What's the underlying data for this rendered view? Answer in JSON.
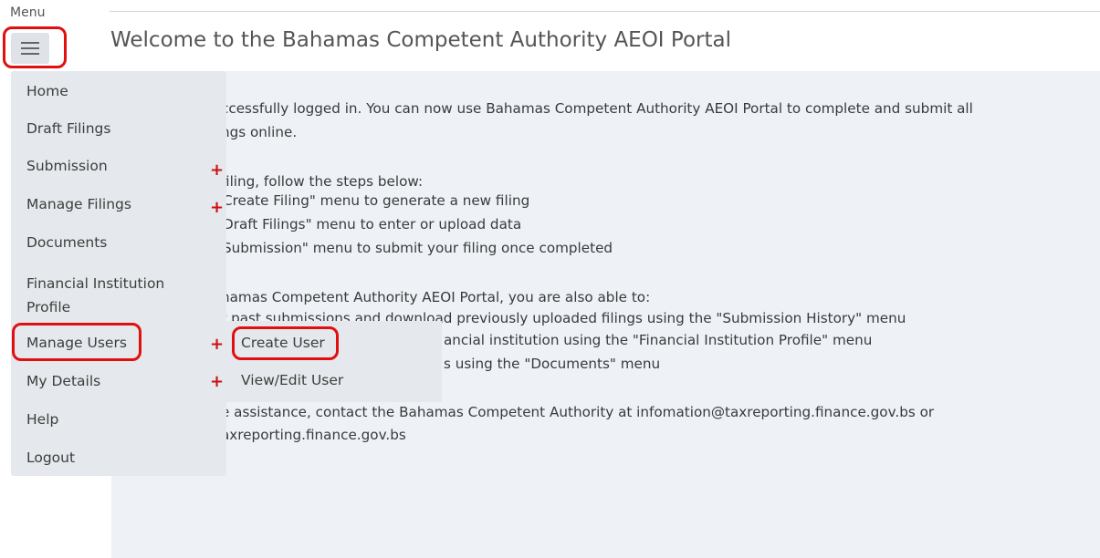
{
  "menu": {
    "label": "Menu",
    "items": [
      {
        "label": "Home"
      },
      {
        "label": "Draft Filings"
      },
      {
        "label": "Submission",
        "expand_symbol": "+"
      },
      {
        "label": "Manage Filings",
        "expand_symbol": "+"
      },
      {
        "label": "Documents"
      },
      {
        "label": "Financial Institution Profile"
      },
      {
        "label": "Manage Users",
        "expand_symbol": "+"
      },
      {
        "label": "My Details"
      },
      {
        "label": "Help"
      },
      {
        "label": "Logout"
      }
    ],
    "submenu": [
      {
        "label": "Create User",
        "expand_symbol": "+"
      },
      {
        "label": "View/Edit User",
        "expand_symbol": "+"
      }
    ]
  },
  "page": {
    "title": "Welcome to the Bahamas Competent Authority AEOI Portal",
    "lines": [
      "ccessfully logged in. You can now use Bahamas Competent Authority AEOI Portal to complete and submit all",
      "ngs online.",
      "filing, follow the steps below:",
      "Create Filing\" menu to generate a new filing",
      "Draft Filings\" menu to enter or upload data",
      "Submission\" menu to submit your filing once completed",
      "hamas Competent Authority AEOI Portal, you are also able to:",
      "r past submissions and download previously uploaded filings using the \"Submission History\" menu",
      "ancial institution using the \"Financial Institution Profile\" menu",
      "s using the \"Documents\" menu",
      "e assistance, contact the Bahamas Competent Authority at infomation@taxreporting.finance.gov.bs or",
      "axreporting.finance.gov.bs"
    ]
  },
  "colors": {
    "highlight": "#e01010",
    "plus": "#cc1111",
    "sidebar_bg": "#e5e8ec",
    "content_bg": "#eef2f7"
  }
}
